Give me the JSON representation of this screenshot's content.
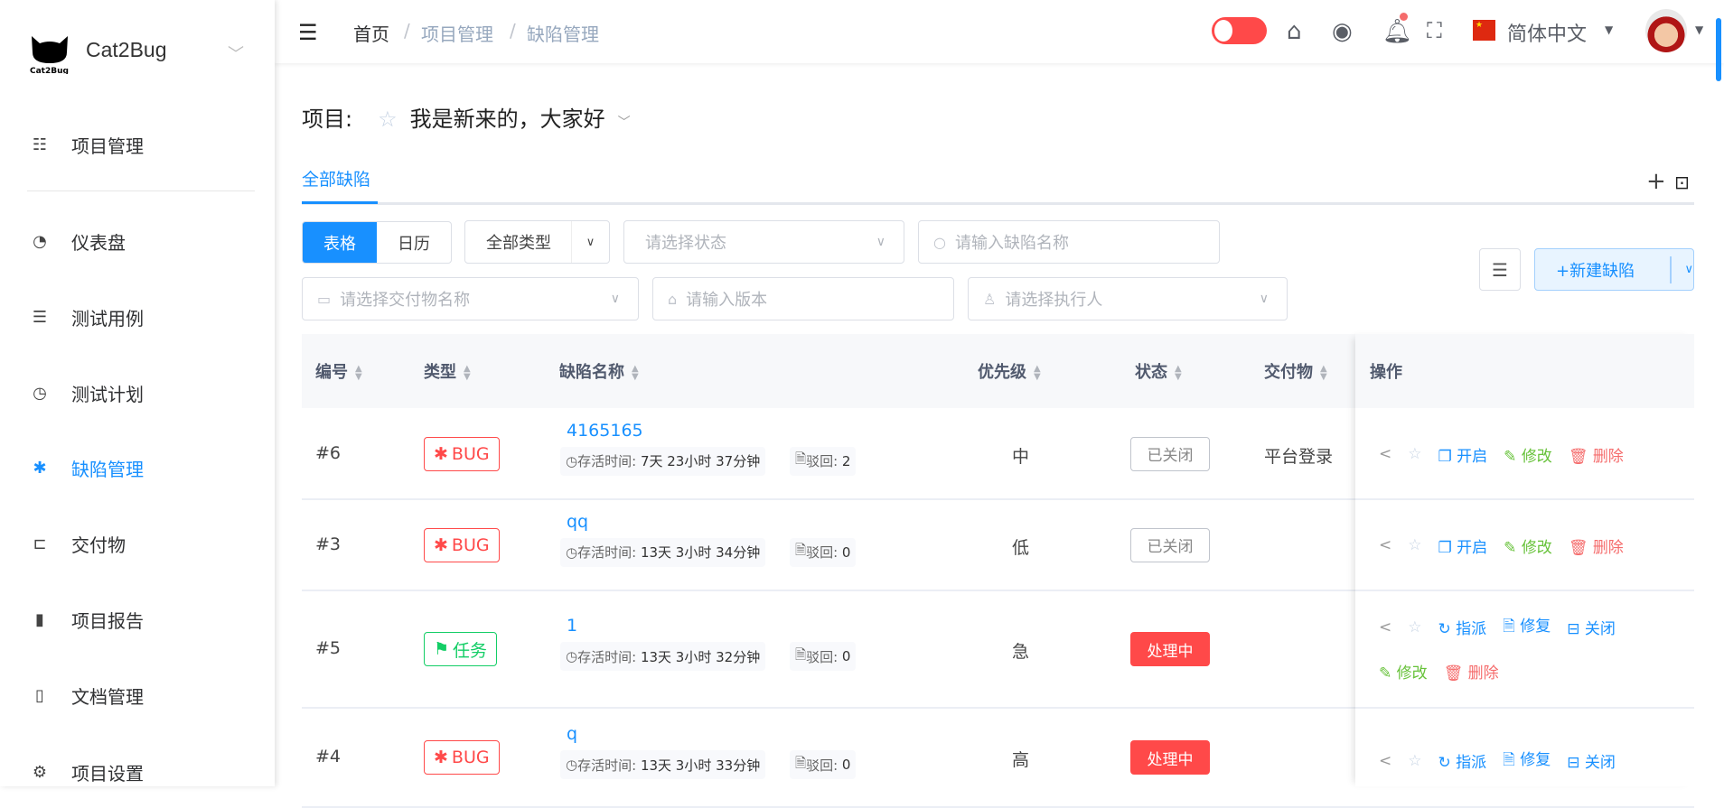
{
  "sidebar": {
    "brand": "Cat2Bug",
    "logo_text": "Cat2Bug",
    "items": [
      {
        "label": "项目管理",
        "icon": "list-icon"
      },
      {
        "label": "仪表盘",
        "icon": "dashboard-icon"
      },
      {
        "label": "测试用例",
        "icon": "list-ordered-icon"
      },
      {
        "label": "测试计划",
        "icon": "clock-icon"
      },
      {
        "label": "缺陷管理",
        "icon": "bug-icon",
        "active": true
      },
      {
        "label": "交付物",
        "icon": "tree-icon"
      },
      {
        "label": "项目报告",
        "icon": "bar-chart-icon"
      },
      {
        "label": "文档管理",
        "icon": "book-icon"
      },
      {
        "label": "项目设置",
        "icon": "gear-icon"
      }
    ]
  },
  "header": {
    "breadcrumb": [
      "首页",
      "项目管理",
      "缺陷管理"
    ],
    "language": "简体中文",
    "accent": "#1890ff"
  },
  "project": {
    "label": "项目:",
    "name": "我是新来的，大家好"
  },
  "tabs": [
    {
      "label": "全部缺陷"
    }
  ],
  "filters": {
    "view_table": "表格",
    "view_calendar": "日历",
    "type": "全部类型",
    "status_placeholder": "请选择状态",
    "name_placeholder": "请输入缺陷名称",
    "deliverable_placeholder": "请选择交付物名称",
    "version_placeholder": "请输入版本",
    "assignee_placeholder": "请选择执行人"
  },
  "new_button": "+新建缺陷",
  "columns": [
    "编号",
    "类型",
    "缺陷名称",
    "优先级",
    "状态",
    "交付物",
    "操作"
  ],
  "meta_labels": {
    "alive": "存活时间:",
    "reject": "驳回:"
  },
  "rows": [
    {
      "id": "#6",
      "type": "BUG",
      "name": "4165165",
      "alive": "7天 23小时 37分钟",
      "reject": "2",
      "priority": "中",
      "status": "已关闭",
      "deliverable": "平台登录",
      "actions": [
        "开启",
        "修改",
        "删除"
      ]
    },
    {
      "id": "#3",
      "type": "BUG",
      "name": "qq",
      "alive": "13天 3小时 34分钟",
      "reject": "0",
      "priority": "低",
      "status": "已关闭",
      "deliverable": "",
      "actions": [
        "开启",
        "修改",
        "删除"
      ]
    },
    {
      "id": "#5",
      "type": "任务",
      "name": "1",
      "alive": "13天 3小时 32分钟",
      "reject": "0",
      "priority": "急",
      "status": "处理中",
      "deliverable": "",
      "actions": [
        "指派",
        "修复",
        "关闭",
        "修改",
        "删除"
      ]
    },
    {
      "id": "#4",
      "type": "BUG",
      "name": "q",
      "alive": "13天 3小时 33分钟",
      "reject": "0",
      "priority": "高",
      "status": "处理中",
      "deliverable": "",
      "actions": [
        "指派",
        "修复",
        "关闭"
      ]
    }
  ]
}
